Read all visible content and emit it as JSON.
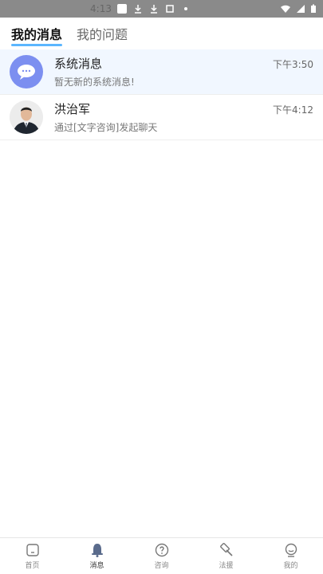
{
  "statusbar": {
    "time": "4:13"
  },
  "tabs": {
    "active": "我的消息",
    "other": "我的问题"
  },
  "messages": [
    {
      "name": "系统消息",
      "time": "下午3:50",
      "preview": "暂无新的系统消息!"
    },
    {
      "name": "洪治军",
      "time": "下午4:12",
      "preview": "通过[文字咨询]发起聊天"
    }
  ],
  "bottom_nav": [
    {
      "label": "首页",
      "icon": "home-icon"
    },
    {
      "label": "消息",
      "icon": "bell-icon"
    },
    {
      "label": "咨询",
      "icon": "question-icon"
    },
    {
      "label": "法援",
      "icon": "gavel-icon"
    },
    {
      "label": "我的",
      "icon": "user-icon"
    }
  ],
  "colors": {
    "accent": "#5bb6ff",
    "system_avatar": "#7c8ff0",
    "highlight_row": "#f1f7ff"
  }
}
